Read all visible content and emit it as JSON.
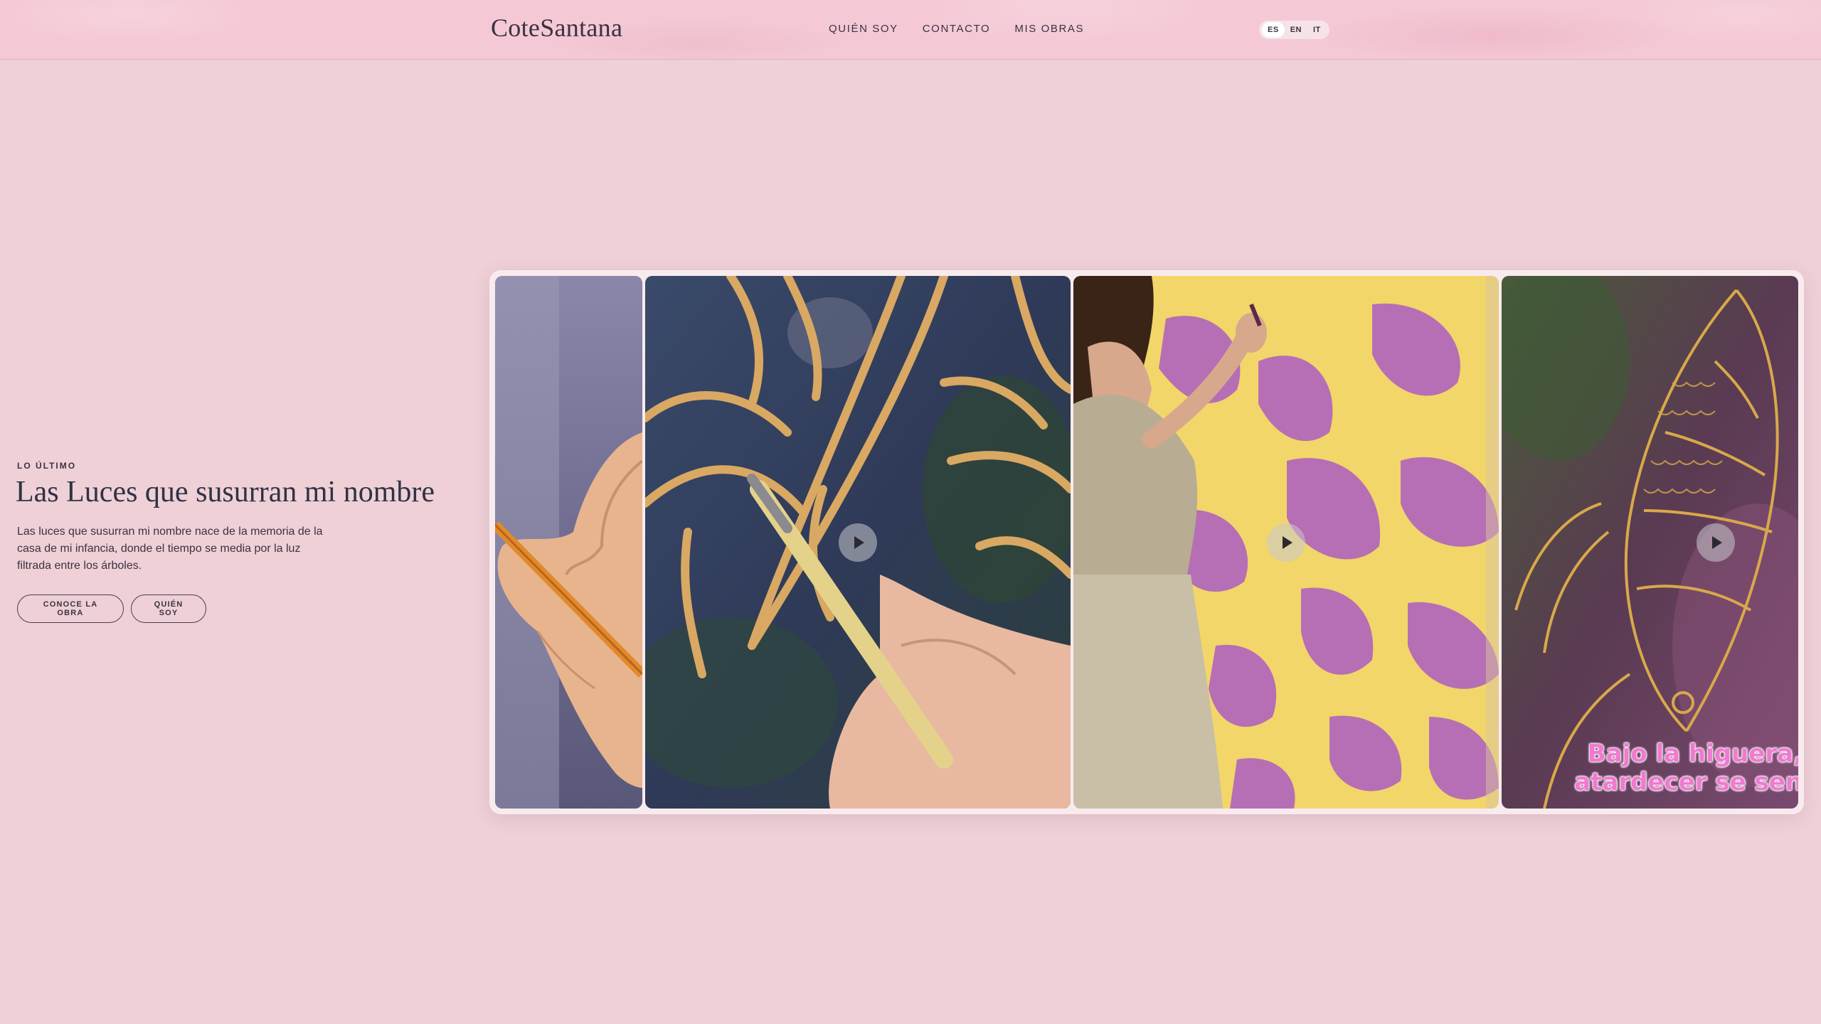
{
  "header": {
    "logo": "CoteSantana",
    "nav": [
      "QUIÉN SOY",
      "CONTACTO",
      "MIS OBRAS"
    ],
    "languages": [
      "ES",
      "EN",
      "IT"
    ],
    "active_language": "ES"
  },
  "hero": {
    "eyebrow": "LO ÚLTIMO",
    "title": "Las Luces que susurran mi nombre",
    "description": "Las luces que susurran mi nombre nace de la memoria de la casa de mi infancia, donde el tiempo se media por la luz filtrada entre los árboles.",
    "buttons": [
      "CONOCE LA OBRA",
      "QUIÉN SOY"
    ]
  },
  "gallery": {
    "overlay_caption_line1": "Bajo la higuera,",
    "overlay_caption_line2": "atardecer se sen"
  },
  "colors": {
    "background": "#efd0d7",
    "header": "#f4c9d5",
    "text": "#3b3240",
    "caption_pink": "#f07ad0"
  }
}
